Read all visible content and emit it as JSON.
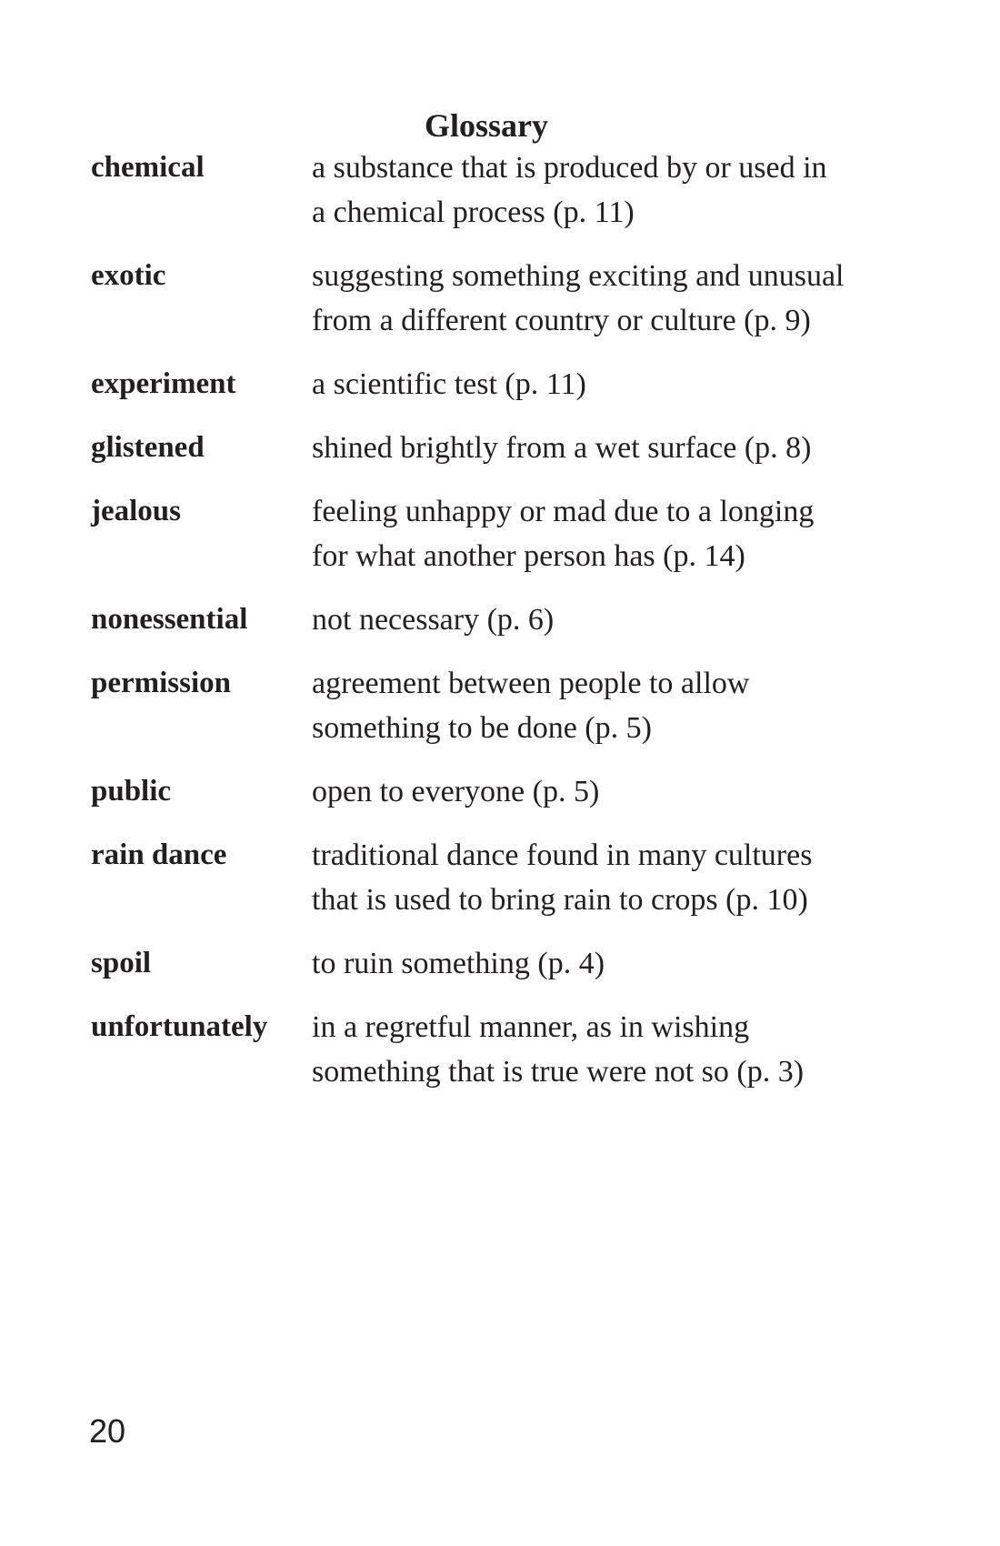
{
  "page": {
    "title": "Glossary",
    "page_number": "20"
  },
  "glossary": [
    {
      "term": "chemical",
      "definition": "a substance that is produced by or used in a chemical process (p. 11)"
    },
    {
      "term": "exotic",
      "definition": "suggesting something exciting and unusual from a different country or culture (p. 9)"
    },
    {
      "term": "experiment",
      "definition": "a scientific test (p. 11)"
    },
    {
      "term": "glistened",
      "definition": "shined brightly from a wet surface (p. 8)"
    },
    {
      "term": "jealous",
      "definition": "feeling unhappy or mad due to a longing for what another person has (p. 14)"
    },
    {
      "term": "nonessential",
      "definition": "not necessary (p. 6)"
    },
    {
      "term": "permission",
      "definition": "agreement between people to allow something to be done (p. 5)"
    },
    {
      "term": "public",
      "definition": "open to everyone (p. 5)"
    },
    {
      "term": "rain dance",
      "definition": "traditional dance found in many cultures that is used to bring rain to crops (p. 10)"
    },
    {
      "term": "spoil",
      "definition": "to ruin something (p. 4)"
    },
    {
      "term": "unfortunately",
      "definition": "in a regretful manner, as in wishing something that is true were not so (p. 3)"
    }
  ]
}
